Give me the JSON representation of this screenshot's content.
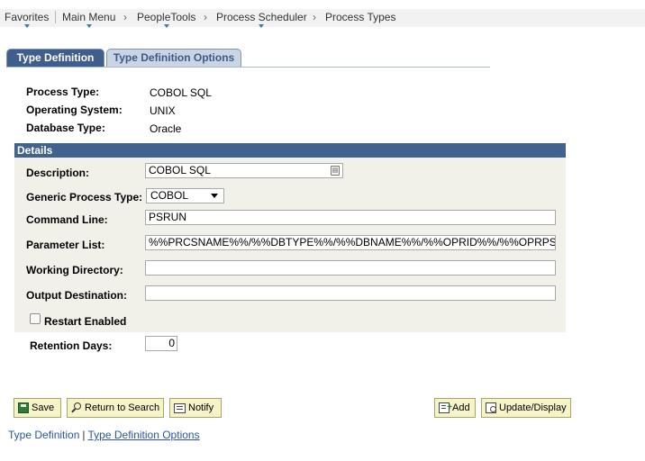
{
  "nav": {
    "favorites": "Favorites",
    "main_menu": "Main Menu",
    "people_tools": "PeopleTools",
    "process_scheduler": "Process Scheduler",
    "process_types": "Process Types",
    "arrow": "›"
  },
  "tabs": {
    "type_definition": "Type Definition",
    "type_definition_options": "Type Definition Options"
  },
  "info": {
    "process_type_label": "Process Type:",
    "process_type_value": "COBOL SQL",
    "os_label": "Operating System:",
    "os_value": "UNIX",
    "db_type_label": "Database Type:",
    "db_type_value": "Oracle"
  },
  "details": {
    "header": "Details",
    "description_label": "Description:",
    "description_value": "COBOL SQL",
    "generic_process_type_label": "Generic Process Type:",
    "generic_process_type_value": "COBOL",
    "command_line_label": "Command Line:",
    "command_line_value": "PSRUN",
    "parameter_list_label": "Parameter List:",
    "parameter_list_value": "%%PRCSNAME%%/%%DBTYPE%%/%%DBNAME%%/%%OPRID%%/%%OPRPSWD%%",
    "working_directory_label": "Working Directory:",
    "working_directory_value": "",
    "output_destination_label": "Output Destination:",
    "output_destination_value": "",
    "restart_enabled_label": "Restart Enabled",
    "restart_enabled_checked": false
  },
  "retention": {
    "label": "Retention Days:",
    "value": "0"
  },
  "buttons": {
    "save": "Save",
    "return_to_search": "Return to Search",
    "notify": "Notify",
    "add": "Add",
    "update_display": "Update/Display"
  },
  "footer": {
    "type_definition": "Type Definition",
    "separator": "|",
    "type_definition_options": "Type Definition Options"
  },
  "colors": {
    "tab_active": "#3f5e8d",
    "tab_inactive": "#c9d5e5",
    "details_header": "#41628f",
    "details_panel": "#f1f1ea",
    "button_bg": "#f5f3c8",
    "link": "#2855a0"
  }
}
